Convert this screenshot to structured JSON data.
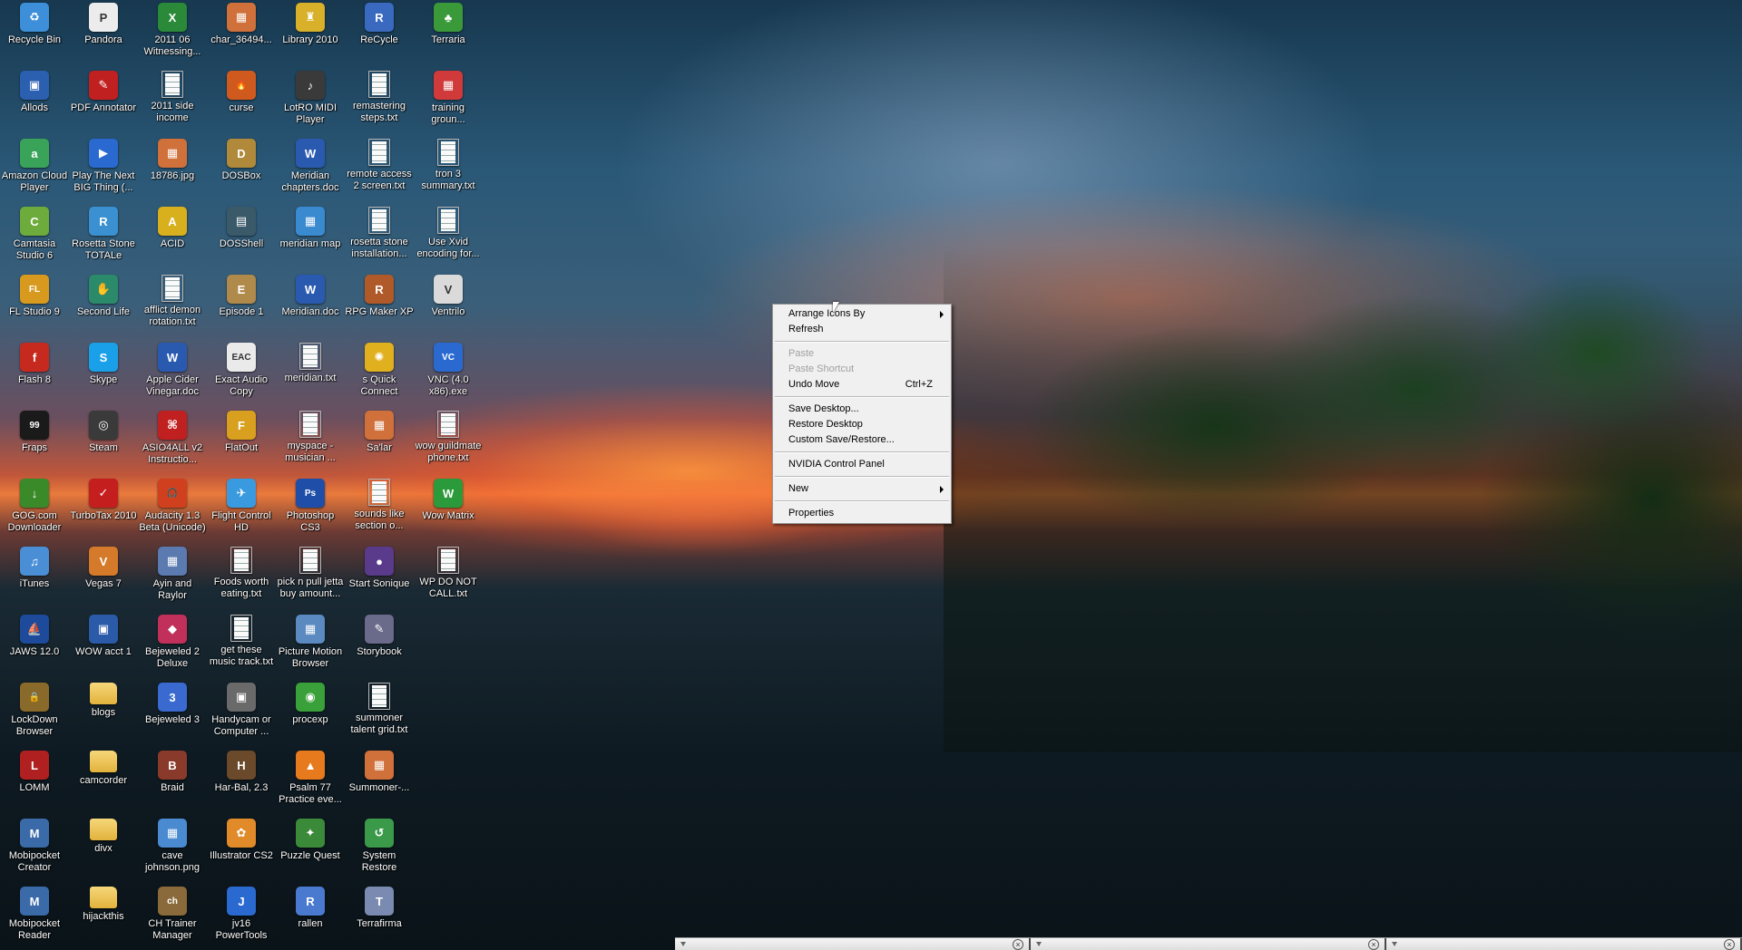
{
  "desktop": {
    "icons": [
      {
        "label": "Recycle Bin",
        "glyph": "recycle-bin-icon",
        "color": "#3c8fd8",
        "char": "♻"
      },
      {
        "label": "Allods",
        "glyph": "window-icon",
        "color": "#2b5fb0",
        "char": "▣"
      },
      {
        "label": "Amazon Cloud Player",
        "glyph": "amazon-icon",
        "color": "#3aa35a",
        "char": "a"
      },
      {
        "label": "Camtasia Studio 6",
        "glyph": "camtasia-icon",
        "color": "#6cab3c",
        "char": "C"
      },
      {
        "label": "FL Studio 9",
        "glyph": "fl-studio-icon",
        "color": "#d89a1e",
        "char": "FL"
      },
      {
        "label": "Flash 8",
        "glyph": "flash-icon",
        "color": "#c62a1e",
        "char": "f"
      },
      {
        "label": "Fraps",
        "glyph": "fraps-icon",
        "color": "#1a1a1a",
        "char": "99"
      },
      {
        "label": "GOG.com Downloader",
        "glyph": "download-icon",
        "color": "#3a8a2a",
        "char": "↓"
      },
      {
        "label": "iTunes",
        "glyph": "itunes-icon",
        "color": "#4a8fd6",
        "char": "♫"
      },
      {
        "label": "JAWS 12.0",
        "glyph": "jaws-icon",
        "color": "#1d4a9a",
        "char": "⛵"
      },
      {
        "label": "LockDown Browser",
        "glyph": "lock-icon",
        "color": "#8a6a2a",
        "char": "🔒"
      },
      {
        "label": "LOMM",
        "glyph": "lomm-icon",
        "color": "#b02020",
        "char": "L"
      },
      {
        "label": "Mobipocket Creator",
        "glyph": "mobipocket-icon",
        "color": "#3a6aa8",
        "char": "M"
      },
      {
        "label": "Mobipocket Reader",
        "glyph": "mobipocket-reader-icon",
        "color": "#3a6aa8",
        "char": "M"
      },
      {
        "label": "Pandora",
        "glyph": "pandora-icon",
        "color": "#ececec",
        "char": "P"
      },
      {
        "label": "PDF Annotator",
        "glyph": "pdf-annotator-icon",
        "color": "#c02020",
        "char": "✎"
      },
      {
        "label": "Play The Next BIG Thing (...",
        "glyph": "play-icon",
        "color": "#2a6ad0",
        "char": "▶"
      },
      {
        "label": "Rosetta Stone TOTALe",
        "glyph": "rosetta-icon",
        "color": "#3a90d0",
        "char": "R"
      },
      {
        "label": "Second Life",
        "glyph": "second-life-icon",
        "color": "#2a8a6a",
        "char": "✋"
      },
      {
        "label": "Skype",
        "glyph": "skype-icon",
        "color": "#1aa0e8",
        "char": "S"
      },
      {
        "label": "Steam",
        "glyph": "steam-icon",
        "color": "#3a3a3a",
        "char": "◎"
      },
      {
        "label": "TurboTax 2010",
        "glyph": "turbotax-icon",
        "color": "#c41e1e",
        "char": "✓"
      },
      {
        "label": "Vegas 7",
        "glyph": "vegas-icon",
        "color": "#d47a2a",
        "char": "V"
      },
      {
        "label": "WOW acct 1",
        "glyph": "window-icon",
        "color": "#2a5aa8",
        "char": "▣"
      },
      {
        "label": "blogs",
        "glyph": "folder-icon",
        "color": "",
        "char": ""
      },
      {
        "label": "camcorder",
        "glyph": "folder-icon",
        "color": "",
        "char": ""
      },
      {
        "label": "divx",
        "glyph": "folder-icon",
        "color": "",
        "char": ""
      },
      {
        "label": "hijackthis",
        "glyph": "folder-icon",
        "color": "",
        "char": ""
      },
      {
        "label": "2011 06 Witnessing...",
        "glyph": "excel-icon",
        "color": "#2a8a3a",
        "char": "X"
      },
      {
        "label": "2011 side income",
        "glyph": "document-icon",
        "color": "",
        "char": ""
      },
      {
        "label": "18786.jpg",
        "glyph": "image-icon",
        "color": "#d0703a",
        "char": "▦"
      },
      {
        "label": "ACID",
        "glyph": "acid-icon",
        "color": "#d8b01e",
        "char": "A"
      },
      {
        "label": "afflict demon rotation.txt",
        "glyph": "document-icon",
        "color": "",
        "char": ""
      },
      {
        "label": "Apple Cider Vinegar.doc",
        "glyph": "word-icon",
        "color": "#2a5ab0",
        "char": "W"
      },
      {
        "label": "ASIO4ALL v2 Instructio...",
        "glyph": "pdf-icon",
        "color": "#c02020",
        "char": "⌘"
      },
      {
        "label": "Audacity 1.3 Beta (Unicode)",
        "glyph": "audacity-icon",
        "color": "#d0401e",
        "char": "🎧"
      },
      {
        "label": "Ayin and Raylor",
        "glyph": "image-icon",
        "color": "#5a7ab0",
        "char": "▦"
      },
      {
        "label": "Bejeweled 2 Deluxe",
        "glyph": "bejeweled-icon",
        "color": "#c0305a",
        "char": "◆"
      },
      {
        "label": "Bejeweled 3",
        "glyph": "bejeweled3-icon",
        "color": "#3a6ad0",
        "char": "3"
      },
      {
        "label": "Braid",
        "glyph": "braid-icon",
        "color": "#8a3a2a",
        "char": "B"
      },
      {
        "label": "cave johnson.png",
        "glyph": "image-icon",
        "color": "#4a8ad0",
        "char": "▦"
      },
      {
        "label": "CH Trainer Manager",
        "glyph": "ch-icon",
        "color": "#8a6a3a",
        "char": "ch"
      },
      {
        "label": "char_36494...",
        "glyph": "image-icon",
        "color": "#d0703a",
        "char": "▦"
      },
      {
        "label": "curse",
        "glyph": "curse-icon",
        "color": "#d05a1e",
        "char": "🔥"
      },
      {
        "label": "DOSBox",
        "glyph": "dosbox-icon",
        "color": "#b08a3a",
        "char": "D"
      },
      {
        "label": "DOSShell",
        "glyph": "dosshell-icon",
        "color": "#3a5a6a",
        "char": "▤"
      },
      {
        "label": "Episode 1",
        "glyph": "episode-icon",
        "color": "#b08a4a",
        "char": "E"
      },
      {
        "label": "Exact Audio Copy",
        "glyph": "eac-icon",
        "color": "#eaeaea",
        "char": "EAC"
      },
      {
        "label": "FlatOut",
        "glyph": "flatout-icon",
        "color": "#d8a01e",
        "char": "F"
      },
      {
        "label": "Flight Control HD",
        "glyph": "flight-icon",
        "color": "#3a9ae0",
        "char": "✈"
      },
      {
        "label": "Foods worth eating.txt",
        "glyph": "document-icon",
        "color": "",
        "char": ""
      },
      {
        "label": "get these music track.txt",
        "glyph": "document-icon",
        "color": "",
        "char": ""
      },
      {
        "label": "Handycam or Computer ...",
        "glyph": "handycam-icon",
        "color": "#6a6a6a",
        "char": "▣"
      },
      {
        "label": "Har-Bal, 2.3",
        "glyph": "harbal-icon",
        "color": "#6a4a2a",
        "char": "H"
      },
      {
        "label": "Illustrator CS2",
        "glyph": "illustrator-icon",
        "color": "#e08a2a",
        "char": "✿"
      },
      {
        "label": "jv16 PowerTools",
        "glyph": "jv16-icon",
        "color": "#2a6ad0",
        "char": "J"
      },
      {
        "label": "Library 2010",
        "glyph": "library-icon",
        "color": "#d8b02a",
        "char": "♜"
      },
      {
        "label": "LotRO MIDI Player",
        "glyph": "lotro-icon",
        "color": "#3a3a3a",
        "char": "♪"
      },
      {
        "label": "Meridian chapters.doc",
        "glyph": "word-icon",
        "color": "#2a5ab0",
        "char": "W"
      },
      {
        "label": "meridian map",
        "glyph": "image-icon",
        "color": "#3a8ad0",
        "char": "▦"
      },
      {
        "label": "Meridian.doc",
        "glyph": "word-icon",
        "color": "#2a5ab0",
        "char": "W"
      },
      {
        "label": "meridian.txt",
        "glyph": "document-icon",
        "color": "",
        "char": ""
      },
      {
        "label": "myspace - musician ...",
        "glyph": "document-icon",
        "color": "",
        "char": ""
      },
      {
        "label": "Photoshop CS3",
        "glyph": "photoshop-icon",
        "color": "#1e4ea8",
        "char": "Ps"
      },
      {
        "label": "pick n pull jetta buy amount...",
        "glyph": "document-icon",
        "color": "",
        "char": ""
      },
      {
        "label": "Picture Motion Browser",
        "glyph": "picture-motion-icon",
        "color": "#5a8ac0",
        "char": "▦"
      },
      {
        "label": "procexp",
        "glyph": "procexp-icon",
        "color": "#3aa03a",
        "char": "◉"
      },
      {
        "label": "Psalm 77 Practice eve...",
        "glyph": "vlc-icon",
        "color": "#e87a1e",
        "char": "▲"
      },
      {
        "label": "Puzzle Quest",
        "glyph": "puzzle-icon",
        "color": "#3a8a3a",
        "char": "✦"
      },
      {
        "label": "rallen",
        "glyph": "rallen-icon",
        "color": "#4a7ad0",
        "char": "R"
      },
      {
        "label": "ReCycle",
        "glyph": "recycle-app-icon",
        "color": "#3a6ac0",
        "char": "R"
      },
      {
        "label": "remastering steps.txt",
        "glyph": "document-icon",
        "color": "",
        "char": ""
      },
      {
        "label": "remote access 2 screen.txt",
        "glyph": "document-icon",
        "color": "",
        "char": ""
      },
      {
        "label": "rosetta stone installation...",
        "glyph": "document-icon",
        "color": "",
        "char": ""
      },
      {
        "label": "RPG Maker XP",
        "glyph": "rpg-maker-icon",
        "color": "#b05a2a",
        "char": "R"
      },
      {
        "label": "s Quick Connect",
        "glyph": "quick-connect-icon",
        "color": "#e0b01e",
        "char": "✺"
      },
      {
        "label": "Sa'lar",
        "glyph": "image-icon",
        "color": "#d0703a",
        "char": "▦"
      },
      {
        "label": "sounds like section o...",
        "glyph": "document-icon",
        "color": "",
        "char": ""
      },
      {
        "label": "Start Sonique",
        "glyph": "sonique-icon",
        "color": "#5a3a8a",
        "char": "●"
      },
      {
        "label": "Storybook",
        "glyph": "storybook-icon",
        "color": "#6a6a8a",
        "char": "✎"
      },
      {
        "label": "summoner talent grid.txt",
        "glyph": "document-icon",
        "color": "",
        "char": ""
      },
      {
        "label": "Summoner-...",
        "glyph": "image-icon",
        "color": "#d0703a",
        "char": "▦"
      },
      {
        "label": "System Restore",
        "glyph": "system-restore-icon",
        "color": "#3a9a4a",
        "char": "↺"
      },
      {
        "label": "Terrafirma",
        "glyph": "terrafirma-icon",
        "color": "#7a8ab0",
        "char": "T"
      },
      {
        "label": "Terraria",
        "glyph": "terraria-icon",
        "color": "#3a9a3a",
        "char": "♣"
      },
      {
        "label": "training groun...",
        "glyph": "image-icon",
        "color": "#d03a3a",
        "char": "▦"
      },
      {
        "label": "tron 3 summary.txt",
        "glyph": "document-icon",
        "color": "",
        "char": ""
      },
      {
        "label": "Use Xvid encoding for...",
        "glyph": "document-icon",
        "color": "",
        "char": ""
      },
      {
        "label": "Ventrilo",
        "glyph": "ventrilo-icon",
        "color": "#dadada",
        "char": "V"
      },
      {
        "label": "VNC (4.0 x86).exe",
        "glyph": "vnc-icon",
        "color": "#2a6ad0",
        "char": "VC"
      },
      {
        "label": "wow guildmate phone.txt",
        "glyph": "document-icon",
        "color": "",
        "char": ""
      },
      {
        "label": "Wow Matrix",
        "glyph": "wow-matrix-icon",
        "color": "#2a9a3a",
        "char": "W"
      },
      {
        "label": "WP DO NOT CALL.txt",
        "glyph": "document-icon",
        "color": "",
        "char": ""
      }
    ]
  },
  "context_menu": {
    "items": [
      {
        "label": "Arrange Icons By",
        "submenu": true,
        "enabled": true,
        "shortcut": ""
      },
      {
        "label": "Refresh",
        "submenu": false,
        "enabled": true,
        "shortcut": ""
      },
      {
        "separator": true
      },
      {
        "label": "Paste",
        "submenu": false,
        "enabled": false,
        "shortcut": ""
      },
      {
        "label": "Paste Shortcut",
        "submenu": false,
        "enabled": false,
        "shortcut": ""
      },
      {
        "label": "Undo Move",
        "submenu": false,
        "enabled": true,
        "shortcut": "Ctrl+Z"
      },
      {
        "separator": true
      },
      {
        "label": "Save Desktop...",
        "submenu": false,
        "enabled": true,
        "shortcut": ""
      },
      {
        "label": "Restore Desktop",
        "submenu": false,
        "enabled": true,
        "shortcut": ""
      },
      {
        "label": "Custom Save/Restore...",
        "submenu": false,
        "enabled": true,
        "shortcut": ""
      },
      {
        "separator": true
      },
      {
        "label": "NVIDIA Control Panel",
        "submenu": false,
        "enabled": true,
        "shortcut": ""
      },
      {
        "separator": true
      },
      {
        "label": "New",
        "submenu": true,
        "enabled": true,
        "shortcut": ""
      },
      {
        "separator": true
      },
      {
        "label": "Properties",
        "submenu": false,
        "enabled": true,
        "shortcut": ""
      }
    ]
  },
  "bottom_bar": {
    "segments": 3,
    "close_glyph": "×"
  }
}
